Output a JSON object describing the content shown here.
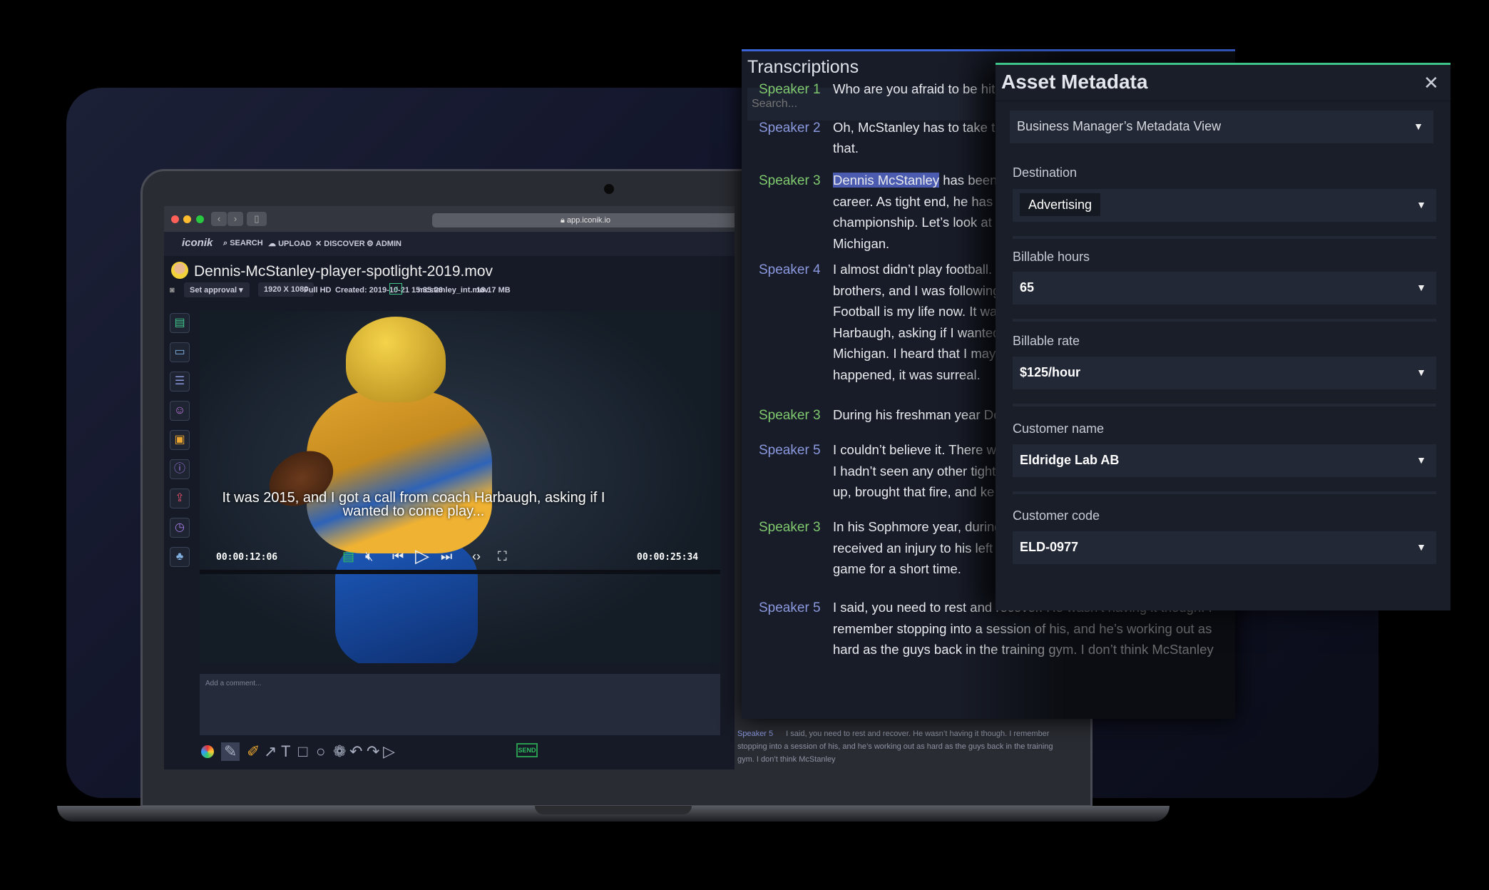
{
  "browser": {
    "url": "app.iconik.io"
  },
  "app": {
    "logo": "iconik",
    "nav": [
      "SEARCH",
      "UPLOAD",
      "DISCOVER",
      "ADMIN"
    ]
  },
  "asset": {
    "filename": "Dennis-McStanley-player-spotlight-2019.mov",
    "approval": "Set approval",
    "resolution": "1920 X 1080",
    "quality": "Full HD",
    "created": "Created: 2019-10-21 15:35:26",
    "source_file": "mcstanley_int.mov",
    "size": "18.17 MB"
  },
  "player": {
    "subtitle": "It was 2015, and I got a call from coach Harbaugh, asking if I wanted to come play...",
    "current_time": "00:00:12:06",
    "duration": "00:00:25:34"
  },
  "comment": {
    "placeholder": "Add a comment...",
    "send": "SEND"
  },
  "sidebar_icons": [
    "document-icon",
    "comment-icon",
    "transcript-icon",
    "face-icon",
    "video-icon",
    "info-icon",
    "share-icon",
    "history-icon",
    "hierarchy-icon"
  ],
  "transcriptions": {
    "title": "Transcriptions",
    "search_placeholder": "Search...",
    "entries": [
      {
        "speaker": "Speaker 1",
        "color": "green",
        "text": "Who are you afraid to be hit"
      },
      {
        "speaker": "Speaker 2",
        "color": "blue",
        "text": "Oh, McStanley has to take th\nthat."
      },
      {
        "speaker": "Speaker 3",
        "color": "green",
        "highlight": "Dennis McStanley",
        "text": " has been a\ncareer. As tight end, he has h\nchampionship. Let’s look at\nMichigan."
      },
      {
        "speaker": "Speaker 4",
        "color": "blue",
        "text": "I almost didn’t play football.\nbrothers, and I was following\nFootball is my life now. It wa\nHarbaugh, asking if I wanted\nMichigan. I heard that I may\nhappened, it was surreal."
      },
      {
        "speaker": "Speaker 3",
        "color": "green",
        "text": "During his freshman year De"
      },
      {
        "speaker": "Speaker 5",
        "color": "blue",
        "text": "I couldn’t believe it. There w\nI hadn’t seen any other tight\nup, brought that fire, and ke"
      },
      {
        "speaker": "Speaker 3",
        "color": "green",
        "text": "In his Sophmore year, during\nreceived an injury to his left shoulder\ngame for a short time."
      },
      {
        "speaker": "Speaker 5",
        "color": "blue",
        "text": "I said, you need to rest and recover. He wasn’t having it though. I\nremember stopping into a session of his, and he’s working out as\nhard as the guys back in the training gym. I don’t think McStanley"
      }
    ],
    "ghost": {
      "speaker": "Speaker 5",
      "text": "I said, you need to rest and recover. He wasn’t having it though. I remember stopping into a session of his, and he’s working out as hard as the guys back in the training gym. I don’t think McStanley"
    }
  },
  "metadata": {
    "title": "Asset Metadata",
    "view": "Business Manager’s Metadata View",
    "fields": [
      {
        "label": "Destination",
        "value": "Advertising"
      },
      {
        "label": "Billable hours",
        "value": "65"
      },
      {
        "label": "Billable rate",
        "value": "$125/hour"
      },
      {
        "label": "Customer name",
        "value": "Eldridge Lab AB"
      },
      {
        "label": "Customer code",
        "value": "ELD-0977"
      }
    ]
  },
  "colors": {
    "speaker_green": "#7fc96e",
    "speaker_blue": "#8a98de",
    "metadata_accent": "#3fc48a",
    "transcription_accent": "#3b63d8"
  }
}
